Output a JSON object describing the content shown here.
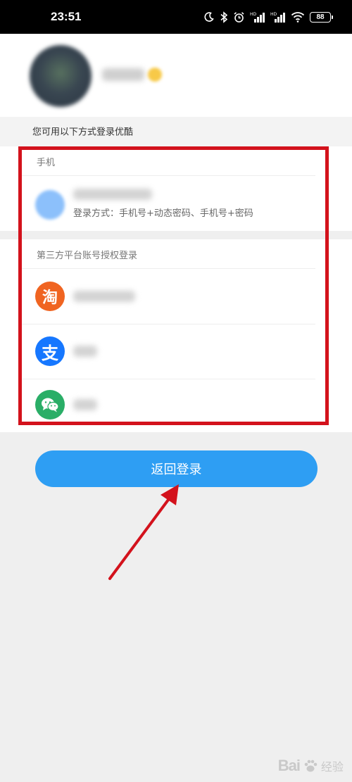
{
  "status_bar": {
    "time": "23:51",
    "icons": [
      "moon-icon",
      "bluetooth-icon",
      "alarm-icon",
      "signal-hd-icon",
      "signal-hd-icon",
      "wifi-icon",
      "battery-icon"
    ],
    "battery": "88"
  },
  "profile": {
    "avatar": "avatar",
    "badge_icon": "vip-badge-icon"
  },
  "login_options": {
    "hint": "您可用以下方式登录优酷",
    "phone_group": {
      "title": "手机",
      "login_method": "登录方式：手机号+动态密码、手机号+密码"
    },
    "third_party_group": {
      "title": "第三方平台账号授权登录",
      "platforms": [
        {
          "name": "taobao",
          "icon": "taobao-icon",
          "glyph": "淘",
          "color": "#f06421"
        },
        {
          "name": "alipay",
          "icon": "alipay-icon",
          "glyph": "支",
          "color": "#1677ff"
        },
        {
          "name": "wechat",
          "icon": "wechat-icon",
          "glyph": "",
          "color": "#2aae67"
        }
      ]
    }
  },
  "actions": {
    "back_to_login": "返回登录"
  },
  "annotations": {
    "highlight_color": "#d3121c",
    "arrow_color": "#d3121c"
  },
  "watermark": {
    "text": "Bai",
    "sub": "经验"
  },
  "colors": {
    "primary": "#2e9ef3",
    "background": "#efefef"
  }
}
